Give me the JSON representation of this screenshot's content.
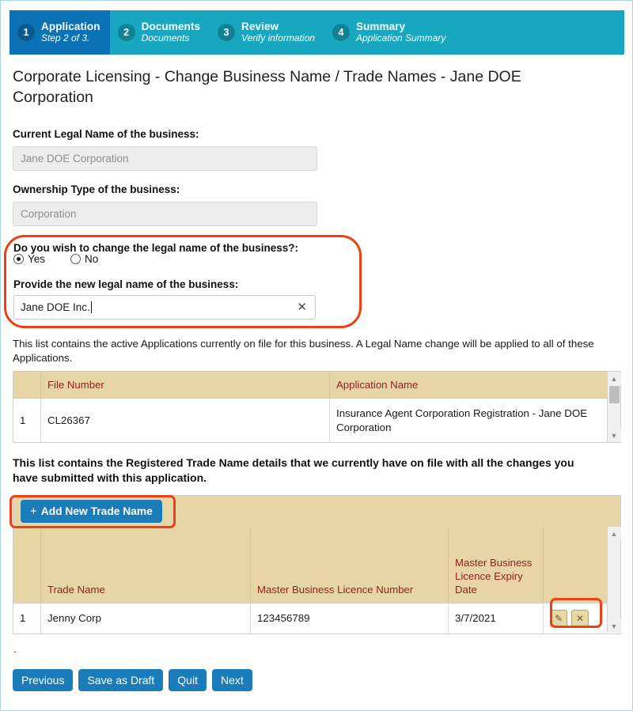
{
  "wizard": {
    "steps": [
      {
        "num": "1",
        "title": "Application",
        "sub": "Step 2 of 3.",
        "active": true
      },
      {
        "num": "2",
        "title": "Documents",
        "sub": "Documents",
        "active": false
      },
      {
        "num": "3",
        "title": "Review",
        "sub": "Verify information",
        "active": false
      },
      {
        "num": "4",
        "title": "Summary",
        "sub": "Application Summary",
        "active": false
      }
    ]
  },
  "page": {
    "title": "Corporate Licensing - Change Business Name / Trade Names - Jane DOE Corporation"
  },
  "form": {
    "current_legal_name_label": "Current Legal Name of the business:",
    "current_legal_name_value": "Jane DOE Corporation",
    "ownership_type_label": "Ownership Type of the business:",
    "ownership_type_value": "Corporation",
    "change_question_label": "Do you wish to change the legal name of the business?:",
    "radio_yes": "Yes",
    "radio_no": "No",
    "radio_selected": "Yes",
    "new_legal_name_label": "Provide the new legal name of the business:",
    "new_legal_name_value": "Jane DOE Inc.",
    "clear_icon": "✕"
  },
  "applications": {
    "description": "This list contains the active Applications currently on file for this business. A Legal Name change will be applied to all of these Applications.",
    "columns": [
      "",
      "File Number",
      "Application Name"
    ],
    "rows": [
      {
        "index": "1",
        "file_number": "CL26367",
        "application_name": "Insurance Agent Corporation Registration - Jane DOE Corporation"
      }
    ]
  },
  "trade_names": {
    "description": "This list contains the Registered Trade Name details that we currently have on file with all the changes you have submitted with this application.",
    "add_button_label": "Add New Trade Name",
    "add_button_icon": "+",
    "columns": [
      "",
      "Trade Name",
      "Master Business Licence Number",
      "Master Business Licence Expiry Date",
      ""
    ],
    "rows": [
      {
        "index": "1",
        "trade_name": "Jenny Corp",
        "mbl_number": "123456789",
        "expiry_date": "3/7/2021",
        "edit_icon": "✎",
        "delete_icon": "✕"
      }
    ]
  },
  "footer": {
    "marker": ".",
    "buttons": [
      {
        "label": "Previous"
      },
      {
        "label": "Save as Draft"
      },
      {
        "label": "Quit"
      },
      {
        "label": "Next"
      }
    ]
  },
  "colors": {
    "step_active": "#0b72b5",
    "step_inactive": "#17a7c1",
    "button_blue": "#1a7cb8",
    "table_header_tan": "#e8d5a5",
    "table_header_text": "#8f1f1f",
    "highlight_red": "#ef3f14",
    "readonly_field_bg": "#ededed"
  }
}
